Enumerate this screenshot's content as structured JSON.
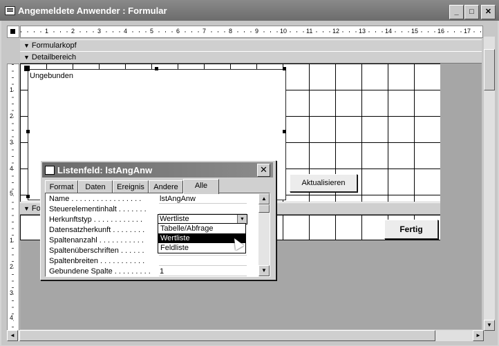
{
  "window": {
    "title": "Angemeldete Anwender : Formular",
    "min_label": "_",
    "max_label": "□",
    "close_label": "✕"
  },
  "ruler": {
    "numbers": [
      "1",
      "2",
      "3",
      "4",
      "5",
      "6",
      "7",
      "8",
      "9",
      "10",
      "11",
      "12",
      "13",
      "14",
      "15",
      "16",
      "17"
    ],
    "v_numbers": [
      "1",
      "2",
      "3",
      "4",
      "5",
      "1",
      "2",
      "3",
      "4"
    ]
  },
  "sections": {
    "header": "Formularkopf",
    "detail": "Detailbereich",
    "footer": "Fo"
  },
  "design": {
    "listbox_label": "Ungebunden",
    "refresh_button": "Aktualisieren",
    "done_button": "Fertig"
  },
  "property_sheet": {
    "title": "Listenfeld: lstAngAnw",
    "close_label": "✕",
    "tabs": [
      "Format",
      "Daten",
      "Ereignis",
      "Andere",
      "Alle"
    ],
    "active_tab": "Alle",
    "rows": [
      {
        "name": "Name . . . . . . . . . . . . . . . . .",
        "value": "lstAngAnw"
      },
      {
        "name": "Steuerelementinhalt . . . . . . .",
        "value": ""
      },
      {
        "name": "Herkunftstyp . . . . . . . . . . . .",
        "value": ""
      },
      {
        "name": "Datensatzherkunft . . . . . . . .",
        "value": ""
      },
      {
        "name": "Spaltenanzahl . . . . . . . . . . .",
        "value": ""
      },
      {
        "name": "Spaltenüberschriften . . . . . .",
        "value": ""
      },
      {
        "name": "Spaltenbreiten . . . . . . . . . . .",
        "value": ""
      },
      {
        "name": "Gebundene Spalte . . . . . . . . .",
        "value": "1"
      }
    ],
    "dropdown": {
      "value": "Wertliste",
      "options": [
        "Tabelle/Abfrage",
        "Wertliste",
        "Feldliste"
      ],
      "selected_index": 1
    }
  },
  "icons": {
    "arrow": "▼",
    "up": "▲",
    "left": "◄",
    "right": "►"
  }
}
